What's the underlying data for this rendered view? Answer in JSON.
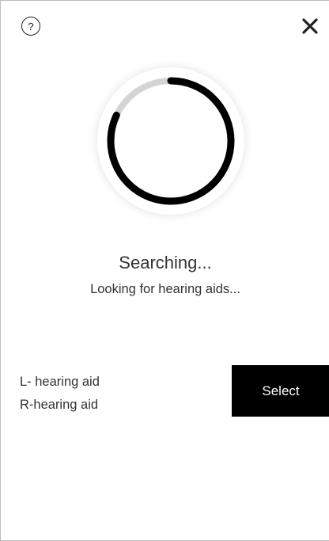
{
  "header": {
    "help_icon_glyph": "?",
    "help_icon": "question-circle-icon",
    "close_icon": "close-icon"
  },
  "spinner": {
    "progress": 0.82,
    "arc_color": "#000000",
    "track_color": "#d4d4d4"
  },
  "status": {
    "title": "Searching...",
    "subtitle": "Looking for hearing aids..."
  },
  "devices": [
    {
      "label": "L- hearing aid"
    },
    {
      "label": "R-hearing aid"
    }
  ],
  "actions": {
    "select_label": "Select"
  }
}
